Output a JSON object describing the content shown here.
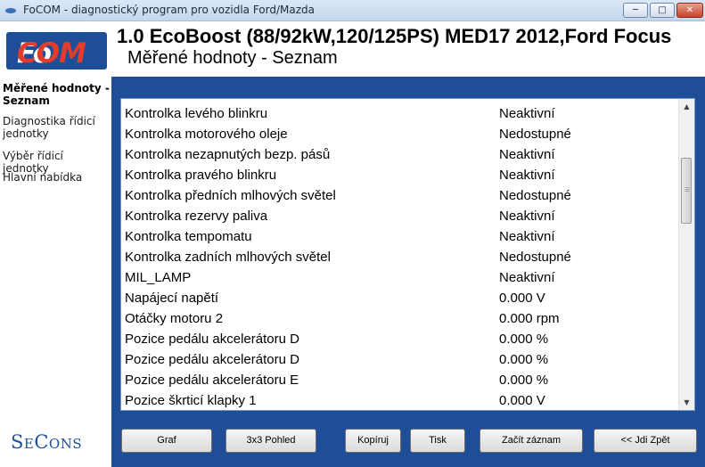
{
  "window": {
    "title": "FoCOM - diagnostický program pro vozidla Ford/Mazda"
  },
  "header": {
    "logo": {
      "fo": "Fo",
      "com": "COM"
    },
    "vehicle": "1.0 EcoBoost (88/92kW,120/125PS) MED17 2012,Ford Focus",
    "subtitle": "Měřené hodnoty - Seznam"
  },
  "sidebar": {
    "items": [
      {
        "label": "Měřené hodnoty - Seznam",
        "active": true
      },
      {
        "label": "Diagnostika řídicí jednotky",
        "active": false
      },
      {
        "label": "Výběr řídicí jednotky",
        "active": false
      },
      {
        "label": "Hlavní nabídka",
        "active": false
      }
    ],
    "brand": {
      "big1": "S",
      "small1": "E",
      "big2": "C",
      "small2": "ONS"
    }
  },
  "list": {
    "rows": [
      {
        "name": "Kontrolka levého blinkru",
        "value": "Neaktivní"
      },
      {
        "name": "Kontrolka motorového oleje",
        "value": "Nedostupné"
      },
      {
        "name": "Kontrolka nezapnutých bezp. pásů",
        "value": "Neaktivní"
      },
      {
        "name": "Kontrolka pravého blinkru",
        "value": "Neaktivní"
      },
      {
        "name": "Kontrolka předních mlhových světel",
        "value": "Nedostupné"
      },
      {
        "name": "Kontrolka rezervy paliva",
        "value": "Neaktivní"
      },
      {
        "name": "Kontrolka tempomatu",
        "value": "Neaktivní"
      },
      {
        "name": "Kontrolka zadních mlhových světel",
        "value": "Nedostupné"
      },
      {
        "name": "MIL_LAMP",
        "value": "Neaktivní"
      },
      {
        "name": "Napájecí napětí",
        "value": "0.000 V"
      },
      {
        "name": "Otáčky motoru 2",
        "value": "0.000 rpm"
      },
      {
        "name": "Pozice pedálu akcelerátoru D",
        "value": "0.000 %"
      },
      {
        "name": "Pozice pedálu akcelerátoru D",
        "value": "0.000 %"
      },
      {
        "name": "Pozice pedálu akcelerátoru E",
        "value": "0.000 %"
      },
      {
        "name": "Pozice škrticí klapky 1",
        "value": "0.000 V"
      }
    ]
  },
  "buttons": {
    "graph": "Graf",
    "view3x3": "3x3 Pohled",
    "copy": "Kopíruj",
    "print": "Tisk",
    "record": "Začít záznam",
    "back": "<< Jdi Zpět"
  },
  "colors": {
    "accent": "#1f4e98",
    "logo_o": "#e33b2c"
  }
}
